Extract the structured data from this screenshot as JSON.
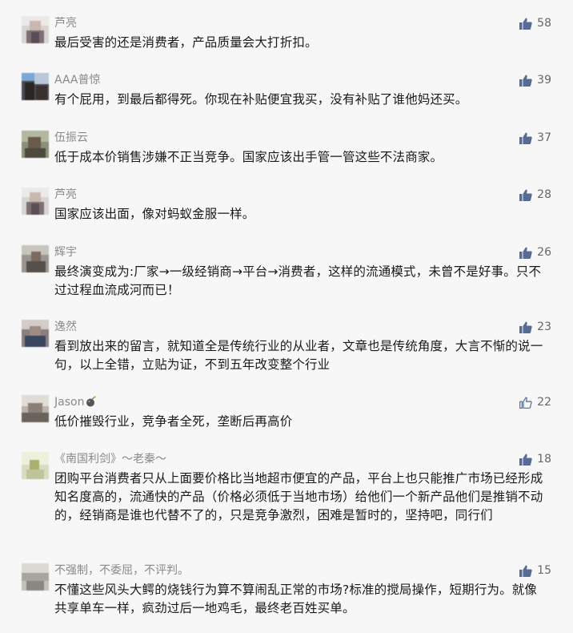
{
  "colors": {
    "background": "#f7f7f7",
    "nickname": "#8a8a8a",
    "text": "#1a1a1a",
    "like_icon": "#576b95"
  },
  "comments": [
    {
      "nickname": "芦亮",
      "text": "最后受害的还是消费者，产品质量会大打折扣。",
      "likes": "58",
      "liked_icon": "thumbs-up-filled-icon"
    },
    {
      "nickname": "AAA普惊",
      "text": "有个屁用，到最后都得死。你现在补贴便宜我买，没有补贴了谁他妈还买。",
      "likes": "39",
      "liked_icon": "thumbs-up-filled-icon"
    },
    {
      "nickname": "伍振云",
      "text": "低于成本价销售涉嫌不正当竞争。国家应该出手管一管这些不法商家。",
      "likes": "37",
      "liked_icon": "thumbs-up-filled-icon"
    },
    {
      "nickname": "芦亮",
      "text": "国家应该出面，像对蚂蚁金服一样。",
      "likes": "28",
      "liked_icon": "thumbs-up-filled-icon"
    },
    {
      "nickname": "辉宇",
      "text": "最终演变成为:厂家→一级经销商→平台→消费者，这样的流通模式，未曾不是好事。只不过过程血流成河而已！",
      "likes": "26",
      "liked_icon": "thumbs-up-filled-icon"
    },
    {
      "nickname": "逸然",
      "text": "看到放出来的留言，就知道全是传统行业的从业者，文章也是传统角度，大言不惭的说一句，以上全错，立贴为证，不到五年改变整个行业",
      "likes": "23",
      "liked_icon": "thumbs-up-filled-icon"
    },
    {
      "nickname": "Jason",
      "text": "低价摧毁行业，竞争者全死，垄断后再高价",
      "likes": "22",
      "liked_icon": "thumbs-up-outline-icon"
    },
    {
      "nickname": "《南国利剑》～老秦～",
      "text": "团购平台消费者只从上面要价格比当地超市便宜的产品，平台上也只能推广市场已经形成知名度高的，流通快的产品（价格必须低于当地市场）给他们一个新产品他们是推销不动的，经销商是谁也代替不了的，只是竞争激烈，困难是暂时的，坚持吧，同行们",
      "likes": "18",
      "liked_icon": "thumbs-up-filled-icon"
    },
    {
      "nickname": "不强制，不委屈，不评判。",
      "text": "不懂这些风头大鳄的烧钱行为算不算闹乱正常的市场?标准的搅局操作，短期行为。就像共享单车一样，疯劲过后一地鸡毛，最终老百姓买单。",
      "likes": "15",
      "liked_icon": "thumbs-up-filled-icon"
    }
  ]
}
